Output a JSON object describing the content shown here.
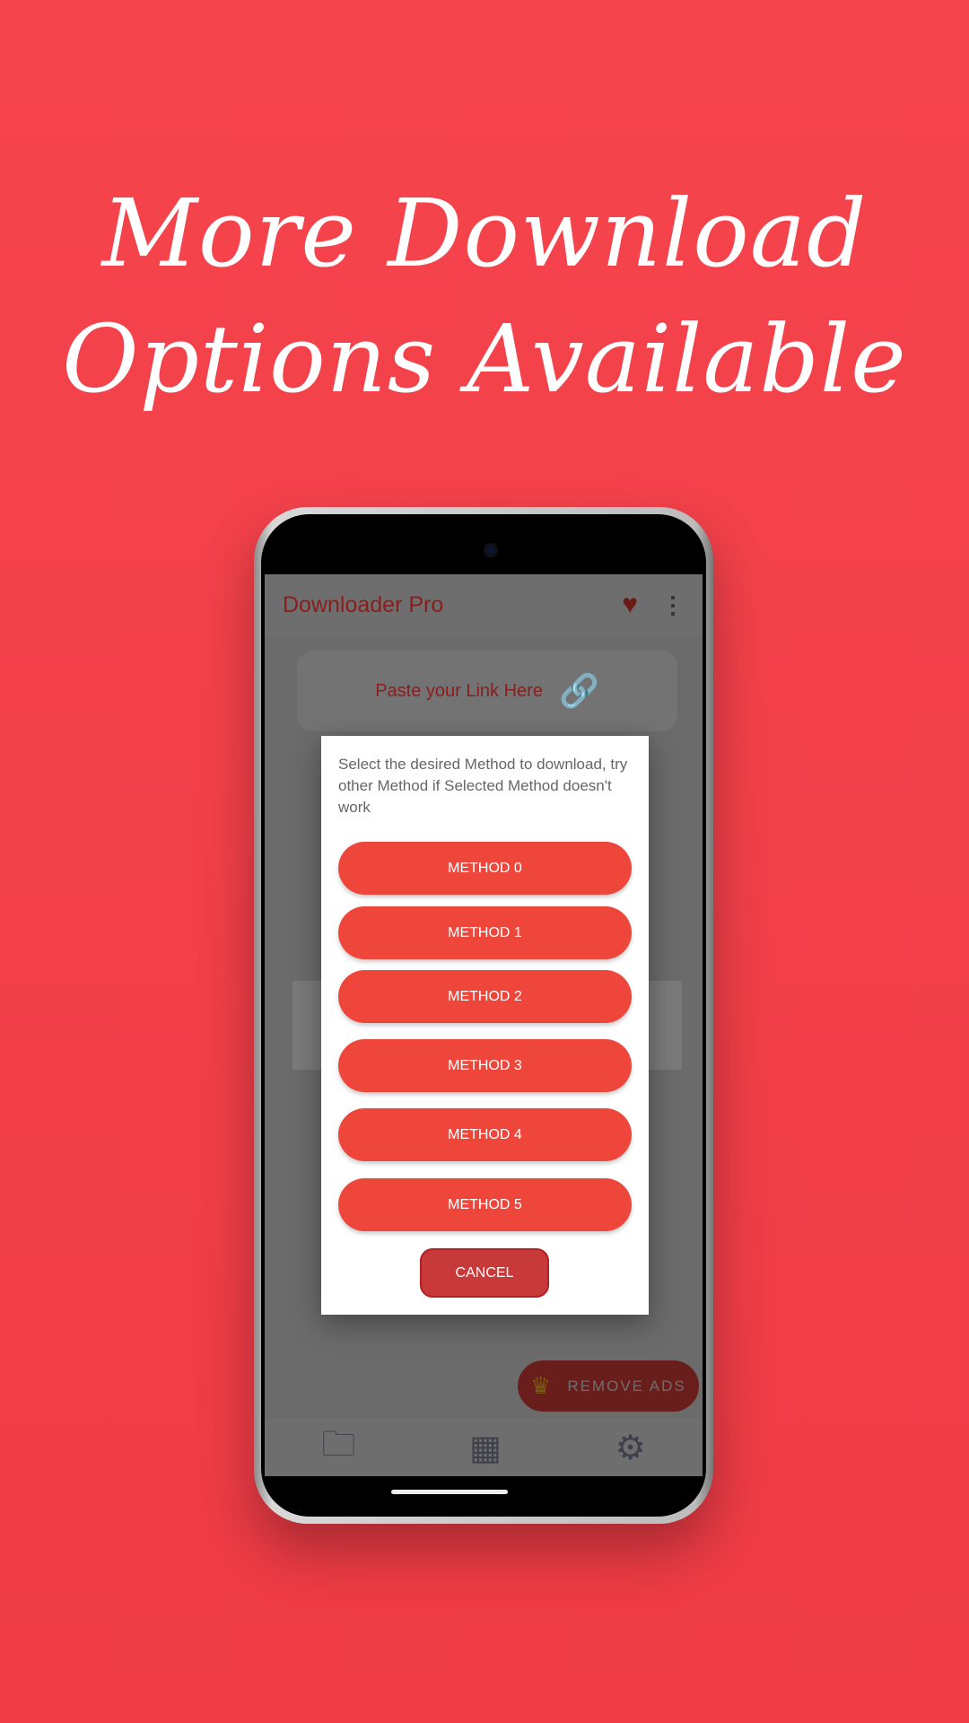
{
  "headline": {
    "line1": "More Download",
    "line2": "Options Available"
  },
  "app": {
    "title": "Downloader Pro",
    "paste_label": "Paste your Link Here"
  },
  "dialog": {
    "message": "Select the desired Method to download, try other Method if Selected Method doesn't work",
    "methods": [
      "METHOD 0",
      "METHOD 1",
      "METHOD 2",
      "METHOD 3",
      "METHOD 4",
      "METHOD 5"
    ],
    "cancel": "CANCEL"
  },
  "remove_ads": "REMOVE ADS",
  "icons": {
    "heart": "heart-icon",
    "menu": "more-vert-icon",
    "link": "broken-link-icon",
    "crown": "crown-icon",
    "nav": [
      "folder-icon",
      "grid-icon",
      "gear-icon"
    ]
  },
  "colors": {
    "background": "#f6444d",
    "method_button": "#ef463b",
    "cancel_button": "#c8393a"
  }
}
